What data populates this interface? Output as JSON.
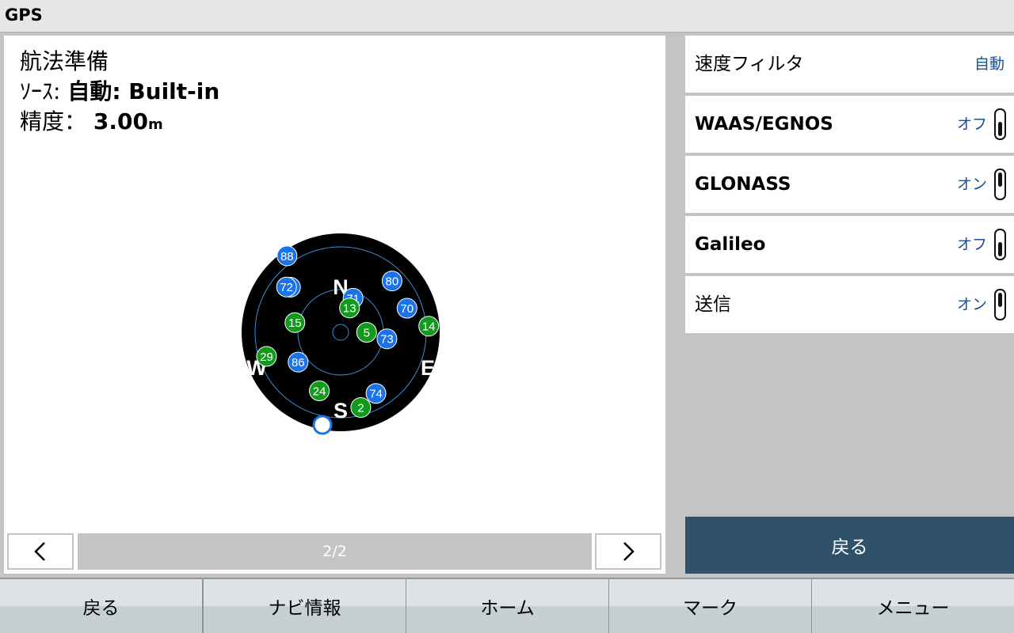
{
  "app": {
    "title": "GPS"
  },
  "status": {
    "nav_state": "航法準備",
    "source_label": "ｿｰｽ:",
    "source_value": "自動: Built-in",
    "accuracy_label": "精度：",
    "accuracy_value": "3.00",
    "accuracy_unit": "m"
  },
  "skyplot": {
    "compass": {
      "north": "N",
      "south": "S",
      "east": "E",
      "west": "W"
    },
    "colors": {
      "gps": "#1a73e8",
      "glonass": "#119a1c",
      "background": "#000000",
      "ring": "#3a8fd8"
    },
    "satellites": [
      {
        "id": "88",
        "system": "gps",
        "azimuth": 325,
        "elevation": 0
      },
      {
        "id": "80",
        "system": "gps",
        "azimuth": 45,
        "elevation": 20
      },
      {
        "id": "87",
        "system": "gps",
        "azimuth": 312,
        "elevation": 25
      },
      {
        "id": "72",
        "system": "gps",
        "azimuth": 310,
        "elevation": 22
      },
      {
        "id": "71",
        "system": "gps",
        "azimuth": 20,
        "elevation": 55
      },
      {
        "id": "70",
        "system": "gps",
        "azimuth": 70,
        "elevation": 22
      },
      {
        "id": "73",
        "system": "gps",
        "azimuth": 98,
        "elevation": 45
      },
      {
        "id": "86",
        "system": "gps",
        "azimuth": 235,
        "elevation": 40
      },
      {
        "id": "74",
        "system": "gps",
        "azimuth": 150,
        "elevation": 22
      },
      {
        "id": "13",
        "system": "glonass",
        "azimuth": 20,
        "elevation": 65
      },
      {
        "id": "15",
        "system": "glonass",
        "azimuth": 282,
        "elevation": 45
      },
      {
        "id": "5",
        "system": "glonass",
        "azimuth": 90,
        "elevation": 65
      },
      {
        "id": "14",
        "system": "glonass",
        "azimuth": 86,
        "elevation": 5
      },
      {
        "id": "29",
        "system": "glonass",
        "azimuth": 252,
        "elevation": 15
      },
      {
        "id": "24",
        "system": "glonass",
        "azimuth": 200,
        "elevation": 30
      },
      {
        "id": "2",
        "system": "glonass",
        "azimuth": 165,
        "elevation": 15
      }
    ]
  },
  "pager": {
    "indicator": "2/2"
  },
  "settings": [
    {
      "name": "速度フィルタ",
      "value": "自動",
      "bold": false,
      "toggle": null
    },
    {
      "name": "WAAS/EGNOS",
      "value": "オフ",
      "bold": true,
      "toggle": "off"
    },
    {
      "name": "GLONASS",
      "value": "オン",
      "bold": true,
      "toggle": "on"
    },
    {
      "name": "Galileo",
      "value": "オフ",
      "bold": true,
      "toggle": "off"
    },
    {
      "name": "送信",
      "value": "オン",
      "bold": false,
      "toggle": "on"
    }
  ],
  "back_button": {
    "label": "戻る"
  },
  "bottom_tabs": [
    {
      "label": "戻る"
    },
    {
      "label": "ナビ情報"
    },
    {
      "label": "ホーム"
    },
    {
      "label": "マーク"
    },
    {
      "label": "メニュー"
    }
  ]
}
